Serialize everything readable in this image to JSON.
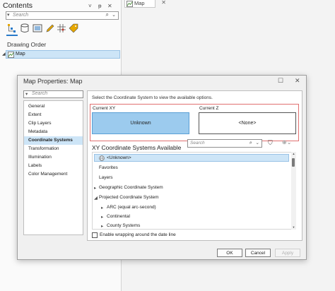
{
  "contents": {
    "title": "Contents",
    "pane_buttons": [
      "˅",
      "ᵽ",
      "✕"
    ],
    "search_placeholder": "Search",
    "drawing_order": "Drawing Order",
    "layers": [
      {
        "label": "Map"
      }
    ]
  },
  "map_tab": {
    "label": "Map"
  },
  "dialog": {
    "title": "Map Properties: Map",
    "sidebar_search_placeholder": "Search",
    "sidebar_items": [
      "General",
      "Extent",
      "Clip Layers",
      "Metadata",
      "Coordinate Systems",
      "Transformation",
      "Illumination",
      "Labels",
      "Color Management"
    ],
    "selected_index": 4,
    "instruction": "Select the Coordinate System to view the available options.",
    "current_xy_label": "Current XY",
    "current_z_label": "Current Z",
    "current_xy_value": "Unknown",
    "current_z_value": "<None>",
    "xy_heading": "XY Coordinate Systems Available",
    "cs_search_placeholder": "Search",
    "cs_items": [
      {
        "label": "<Unknown>"
      },
      {
        "label": "Favorites"
      },
      {
        "label": "Layers"
      },
      {
        "label": "Geographic Coordinate System"
      },
      {
        "label": "Projected Coordinate System"
      },
      {
        "label": "ARC (equal arc-second)"
      },
      {
        "label": "Continental"
      },
      {
        "label": "County Systems"
      }
    ],
    "wrap_label": "Enable wrapping around the date line",
    "ok": "OK",
    "cancel": "Cancel",
    "apply": "Apply"
  }
}
